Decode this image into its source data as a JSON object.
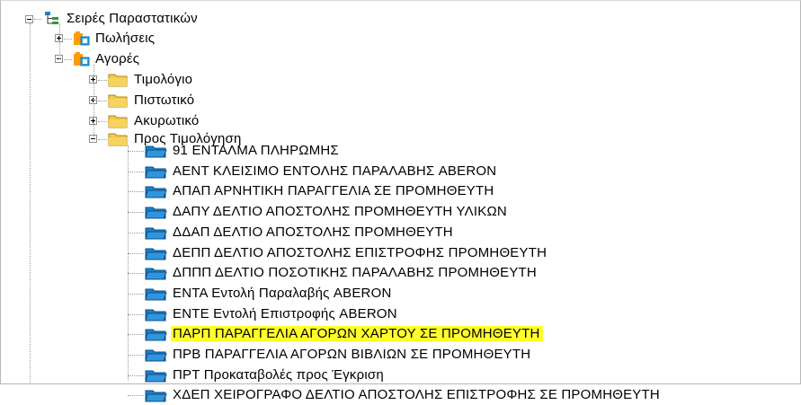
{
  "root": {
    "label": "Σειρές Παραστατικών",
    "icon": "tree-root-icon"
  },
  "sales": {
    "label": "Πωλήσεις",
    "icon": "folder-group-icon"
  },
  "purchases": {
    "label": "Αγορές",
    "icon": "folder-group-icon",
    "children": [
      {
        "label": "Τιμολόγιο",
        "icon": "folder-icon"
      },
      {
        "label": "Πιστωτικό",
        "icon": "folder-icon"
      },
      {
        "label": "Ακυρωτικό",
        "icon": "folder-icon"
      },
      {
        "label": "Προς Τιμολόγηση",
        "icon": "folder-icon"
      }
    ]
  },
  "series": [
    {
      "label": "91 ΕΝΤΑΛΜΑ ΠΛΗΡΩΜΗΣ"
    },
    {
      "label": "ΑΕΝΤ ΚΛΕΙΣΙΜΟ ΕΝΤΟΛΗΣ ΠΑΡΑΛΑΒΗΣ ABERON"
    },
    {
      "label": "ΑΠΑΠ ΑΡΝΗΤΙΚΗ ΠΑΡΑΓΓΕΛΙΑ ΣΕ ΠΡΟΜΗΘΕΥΤΗ"
    },
    {
      "label": "ΔΑΠΥ ΔΕΛΤΙΟ ΑΠΟΣΤΟΛΗΣ ΠΡΟΜΗΘΕΥΤΗ ΥΛΙΚΩΝ"
    },
    {
      "label": "ΔΔΑΠ ΔΕΛΤΙΟ ΑΠΟΣΤΟΛΗΣ ΠΡΟΜΗΘΕΥΤΗ"
    },
    {
      "label": "ΔΕΠΠ ΔΕΛΤΙΟ ΑΠΟΣΤΟΛΗΣ ΕΠΙΣΤΡΟΦΗΣ ΠΡΟΜΗΘΕΥΤΗ"
    },
    {
      "label": "ΔΠΠΠ ΔΕΛΤΙΟ ΠΟΣΟΤΙΚΗΣ ΠΑΡΑΛΑΒΗΣ ΠΡΟΜΗΘΕΥΤΗ"
    },
    {
      "label": "ΕΝΤΑ Εντολή Παραλαβής ABERON"
    },
    {
      "label": "ΕΝΤΕ Εντολή Επιστροφής ABERON"
    },
    {
      "label": "ΠΑΡΠ ΠΑΡΑΓΓΕΛΙΑ ΑΓΟΡΩΝ ΧΑΡΤΟΥ ΣΕ ΠΡΟΜΗΘΕΥΤΗ",
      "highlighted": true
    },
    {
      "label": "ΠΡΒ ΠΑΡΑΓΓΕΛΙΑ ΑΓΟΡΩΝ ΒΙΒΛΙΩΝ ΣΕ ΠΡΟΜΗΘΕΥΤΗ"
    },
    {
      "label": "ΠΡΤ Προκαταβολές προς Έγκριση"
    },
    {
      "label": "ΧΔΕΠ ΧΕΙΡΟΓΡΑΦΟ ΔΕΛΤΙΟ ΑΠΟΣΤΟΛΗΣ ΕΠΙΣΤΡΟΦΗΣ ΣΕ ΠΡΟΜΗΘΕΥΤΗ"
    }
  ],
  "colors": {
    "highlight": "#ffff2a",
    "folder": "#f2c94c",
    "series_icon": "#1e7fc7",
    "group_icon": "#ff9c00"
  }
}
